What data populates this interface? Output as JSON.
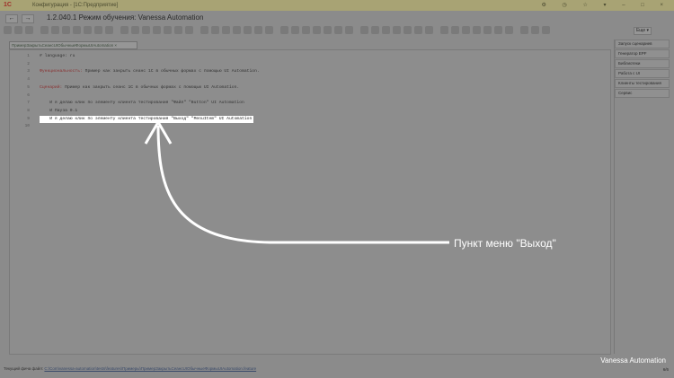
{
  "titlebar": {
    "logo": "1С",
    "title": "Конфигурация - [1С:Предприятие]",
    "controls": "⚙ ◷ ☆ ▾ – □ ×"
  },
  "window": {
    "back": "←",
    "forward": "→",
    "title": "1.2.040.1 Режим обучения: Vanessa Automation"
  },
  "tab": {
    "label": "ПримерЗакрытьСеансUIOбычныеФормыUIAutomation",
    "close": "×"
  },
  "editor": {
    "lines": [
      {
        "n": "1",
        "text": "# language: ru"
      },
      {
        "n": "2",
        "text": ""
      },
      {
        "n": "3",
        "kw": "Функциональность:",
        "text": " Пример как закрыть сеанс 1С в обычных формах с помощью UI Automation."
      },
      {
        "n": "4",
        "text": ""
      },
      {
        "n": "5",
        "kw": "Сценарий:",
        "text": " Пример как закрыть сеанс 1С в обычных формах с помощью UI Automation."
      },
      {
        "n": "6",
        "text": ""
      },
      {
        "n": "7",
        "text": "    И я делаю клик по элементу клиента тестирования \"Файл\" \"Button\" UI Automation"
      },
      {
        "n": "8",
        "text": "    И Пауза 0.1"
      },
      {
        "n": "9",
        "text": "    И я делаю клик по элементу клиента тестирования \"Выход\" \"MenuItem\" UI Automation"
      },
      {
        "n": "10",
        "text": ""
      }
    ]
  },
  "right_panel": {
    "more": "Еще ▾",
    "items": [
      "Запуск сценариев",
      "Генератор EPF",
      "Библиотеки",
      "Работа с UI",
      "Клиенты тестирования",
      "Сервис"
    ]
  },
  "status": {
    "label": "Текущий фича файл:",
    "path": "C:\\Com\\vanessa-automation\\tests\\features\\Примеры\\ПримерЗакрытьСеансUIOбычныеФормыUIAutomation.feature",
    "page": "6/6"
  },
  "annotation": "Пункт меню \"Выход\"",
  "brand": "Vanessa Automation"
}
